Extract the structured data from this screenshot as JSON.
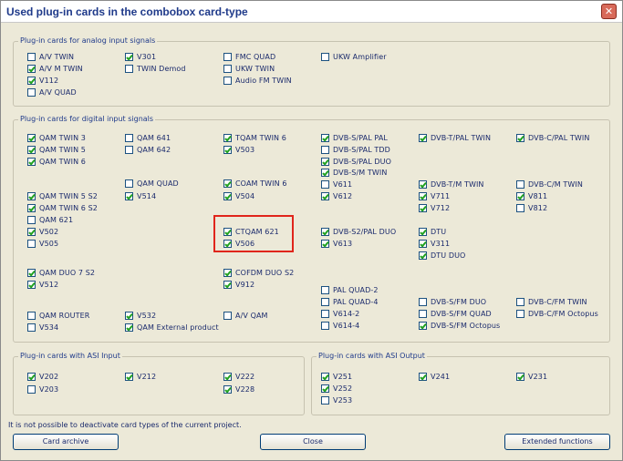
{
  "window": {
    "title": "Used plug-in cards in the combobox card-type",
    "close_glyph": "✕"
  },
  "groups": {
    "analog": {
      "label": "Plug-in cards for analog input signals",
      "items": [
        {
          "label": "A/V TWIN",
          "checked": false
        },
        {
          "label": "A/V M TWIN",
          "checked": true
        },
        {
          "label": "V112",
          "checked": true
        },
        {
          "label": "A/V QUAD",
          "checked": false
        },
        {
          "label": "V301",
          "checked": true
        },
        {
          "label": "TWIN Demod",
          "checked": false
        },
        {
          "label": "FMC QUAD",
          "checked": false
        },
        {
          "label": "UKW TWIN",
          "checked": false
        },
        {
          "label": "Audio FM TWIN",
          "checked": false
        },
        {
          "label": "UKW Amplifier",
          "checked": false
        }
      ]
    },
    "digital": {
      "label": "Plug-in cards for digital input signals",
      "items": [
        {
          "label": "QAM TWIN 3",
          "checked": true
        },
        {
          "label": "QAM TWIN 5",
          "checked": true
        },
        {
          "label": "QAM TWIN 6",
          "checked": true
        },
        {
          "label": "QAM TWIN 5 S2",
          "checked": true
        },
        {
          "label": "QAM TWIN 6 S2",
          "checked": true
        },
        {
          "label": "QAM 621",
          "checked": false
        },
        {
          "label": "V502",
          "checked": true
        },
        {
          "label": "V505",
          "checked": false
        },
        {
          "label": "QAM DUO 7 S2",
          "checked": true
        },
        {
          "label": "V512",
          "checked": true
        },
        {
          "label": "QAM ROUTER",
          "checked": false
        },
        {
          "label": "V534",
          "checked": false
        },
        {
          "label": "QAM 641",
          "checked": false
        },
        {
          "label": "QAM 642",
          "checked": false
        },
        {
          "label": "QAM QUAD",
          "checked": false
        },
        {
          "label": "V514",
          "checked": true
        },
        {
          "label": "V532",
          "checked": true
        },
        {
          "label": "QAM External product",
          "checked": true
        },
        {
          "label": "TQAM TWIN 6",
          "checked": true
        },
        {
          "label": "V503",
          "checked": true
        },
        {
          "label": "COAM TWIN 6",
          "checked": true
        },
        {
          "label": "V504",
          "checked": true
        },
        {
          "label": "CTQAM 621",
          "checked": true
        },
        {
          "label": "V506",
          "checked": true
        },
        {
          "label": "COFDM DUO S2",
          "checked": true
        },
        {
          "label": "V912",
          "checked": true
        },
        {
          "label": "A/V QAM",
          "checked": false
        },
        {
          "label": "DVB-S/PAL PAL",
          "checked": true
        },
        {
          "label": "DVB-S/PAL TDD",
          "checked": false
        },
        {
          "label": "DVB-S/PAL DUO",
          "checked": true
        },
        {
          "label": "DVB-S/M TWIN",
          "checked": true
        },
        {
          "label": "V611",
          "checked": false
        },
        {
          "label": "V612",
          "checked": true
        },
        {
          "label": "DVB-S2/PAL DUO",
          "checked": true
        },
        {
          "label": "V613",
          "checked": true
        },
        {
          "label": "PAL QUAD-2",
          "checked": false
        },
        {
          "label": "PAL QUAD-4",
          "checked": false
        },
        {
          "label": "V614-2",
          "checked": false
        },
        {
          "label": "V614-4",
          "checked": false
        },
        {
          "label": "DVB-T/PAL TWIN",
          "checked": true
        },
        {
          "label": "DVB-T/M TWIN",
          "checked": true
        },
        {
          "label": "V711",
          "checked": true
        },
        {
          "label": "V712",
          "checked": true
        },
        {
          "label": "DTU",
          "checked": true
        },
        {
          "label": "V311",
          "checked": true
        },
        {
          "label": "DTU DUO",
          "checked": true
        },
        {
          "label": "DVB-S/FM DUO",
          "checked": false
        },
        {
          "label": "DVB-S/FM QUAD",
          "checked": false
        },
        {
          "label": "DVB-S/FM Octopus",
          "checked": true
        },
        {
          "label": "DVB-C/PAL TWIN",
          "checked": true
        },
        {
          "label": "DVB-C/M TWIN",
          "checked": false
        },
        {
          "label": "V811",
          "checked": true
        },
        {
          "label": "V812",
          "checked": false
        },
        {
          "label": "DVB-C/FM TWIN",
          "checked": false
        },
        {
          "label": "DVB-C/FM Octopus",
          "checked": false
        }
      ]
    },
    "asi_input": {
      "label": "Plug-in cards with ASI Input",
      "items": [
        {
          "label": "V202",
          "checked": true
        },
        {
          "label": "V203",
          "checked": false
        },
        {
          "label": "V212",
          "checked": true
        },
        {
          "label": "V222",
          "checked": true
        },
        {
          "label": "V228",
          "checked": true
        }
      ]
    },
    "asi_output": {
      "label": "Plug-in cards with ASI Output",
      "items": [
        {
          "label": "V251",
          "checked": true
        },
        {
          "label": "V252",
          "checked": true
        },
        {
          "label": "V253",
          "checked": false
        },
        {
          "label": "V241",
          "checked": true
        },
        {
          "label": "V231",
          "checked": true
        }
      ]
    }
  },
  "notice": "It is not possible to deactivate card types of the current project.",
  "buttons": {
    "card_archive": "Card archive",
    "close": "Close",
    "extended_functions": "Extended functions"
  },
  "colors": {
    "highlight": "#e0251b",
    "check": "#21a121"
  }
}
